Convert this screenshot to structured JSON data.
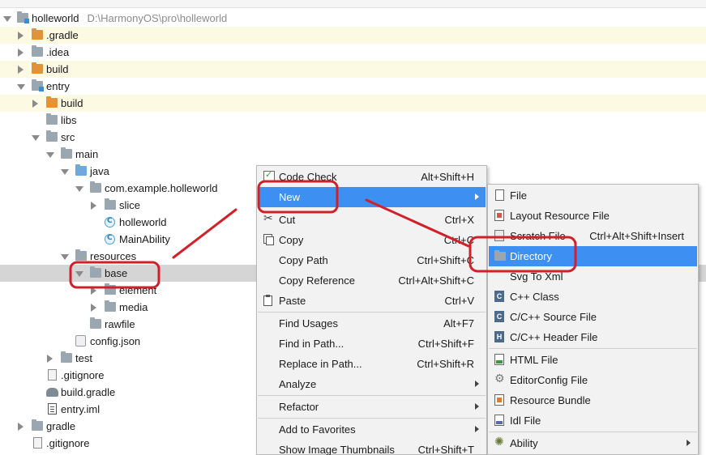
{
  "project": {
    "name": "holleworld",
    "path": "D:\\HarmonyOS\\pro\\holleworld"
  },
  "tree": {
    "items": [
      {
        "label": ".gradle",
        "icon": "folder-orange-icon"
      },
      {
        "label": ".idea",
        "icon": "folder-icon"
      },
      {
        "label": "build",
        "icon": "folder-orange-icon"
      },
      {
        "label": "entry",
        "icon": "module-folder-icon"
      },
      {
        "label": "build",
        "icon": "folder-orange-icon"
      },
      {
        "label": "libs",
        "icon": "folder-icon"
      },
      {
        "label": "src",
        "icon": "folder-icon"
      },
      {
        "label": "main",
        "icon": "folder-icon"
      },
      {
        "label": "java",
        "icon": "source-folder-icon"
      },
      {
        "label": "com.example.holleworld",
        "icon": "package-icon"
      },
      {
        "label": "slice",
        "icon": "package-icon"
      },
      {
        "label": "holleworld",
        "icon": "class-icon"
      },
      {
        "label": "MainAbility",
        "icon": "class-icon"
      },
      {
        "label": "resources",
        "icon": "resources-folder-icon"
      },
      {
        "label": "base",
        "icon": "folder-icon"
      },
      {
        "label": "element",
        "icon": "folder-icon"
      },
      {
        "label": "media",
        "icon": "folder-icon"
      },
      {
        "label": "rawfile",
        "icon": "folder-icon"
      },
      {
        "label": "config.json",
        "icon": "json-file-icon"
      },
      {
        "label": "test",
        "icon": "folder-icon"
      },
      {
        "label": ".gitignore",
        "icon": "gitignore-file-icon"
      },
      {
        "label": "build.gradle",
        "icon": "gradle-icon"
      },
      {
        "label": "entry.iml",
        "icon": "iml-file-icon"
      },
      {
        "label": "gradle",
        "icon": "folder-icon"
      },
      {
        "label": ".gitignore",
        "icon": "gitignore-file-icon"
      }
    ]
  },
  "context_menu": {
    "items": [
      {
        "label": "Code Check",
        "shortcut": "Alt+Shift+H",
        "icon": "code-check-icon"
      },
      {
        "label": "New",
        "shortcut": "",
        "icon": ""
      },
      {
        "label": "Cut",
        "shortcut": "Ctrl+X",
        "icon": "scissors-icon"
      },
      {
        "label": "Copy",
        "shortcut": "Ctrl+C",
        "icon": "copy-icon"
      },
      {
        "label": "Copy Path",
        "shortcut": "Ctrl+Shift+C",
        "icon": ""
      },
      {
        "label": "Copy Reference",
        "shortcut": "Ctrl+Alt+Shift+C",
        "icon": ""
      },
      {
        "label": "Paste",
        "shortcut": "Ctrl+V",
        "icon": "paste-icon"
      },
      {
        "label": "Find Usages",
        "shortcut": "Alt+F7",
        "icon": ""
      },
      {
        "label": "Find in Path...",
        "shortcut": "Ctrl+Shift+F",
        "icon": ""
      },
      {
        "label": "Replace in Path...",
        "shortcut": "Ctrl+Shift+R",
        "icon": ""
      },
      {
        "label": "Analyze",
        "shortcut": "",
        "icon": ""
      },
      {
        "label": "Refactor",
        "shortcut": "",
        "icon": ""
      },
      {
        "label": "Add to Favorites",
        "shortcut": "",
        "icon": ""
      },
      {
        "label": "Show Image Thumbnails",
        "shortcut": "Ctrl+Shift+T",
        "icon": ""
      }
    ]
  },
  "new_submenu": {
    "items": [
      {
        "label": "File",
        "shortcut": "",
        "icon": "file-icon"
      },
      {
        "label": "Layout Resource File",
        "shortcut": "",
        "icon": "layout-file-icon"
      },
      {
        "label": "Scratch File",
        "shortcut": "Ctrl+Alt+Shift+Insert",
        "icon": "scratch-file-icon"
      },
      {
        "label": "Directory",
        "shortcut": "",
        "icon": "directory-icon"
      },
      {
        "label": "Svg To Xml",
        "shortcut": "",
        "icon": ""
      },
      {
        "label": "C++ Class",
        "shortcut": "",
        "icon": "cpp-class-icon"
      },
      {
        "label": "C/C++ Source File",
        "shortcut": "",
        "icon": "cpp-source-icon"
      },
      {
        "label": "C/C++ Header File",
        "shortcut": "",
        "icon": "cpp-header-icon"
      },
      {
        "label": "HTML File",
        "shortcut": "",
        "icon": "html-file-icon"
      },
      {
        "label": "EditorConfig File",
        "shortcut": "",
        "icon": "gear-icon"
      },
      {
        "label": "Resource Bundle",
        "shortcut": "",
        "icon": "resource-bundle-icon"
      },
      {
        "label": "Idl File",
        "shortcut": "",
        "icon": "idl-file-icon"
      },
      {
        "label": "Ability",
        "shortcut": "",
        "icon": "ability-icon"
      }
    ]
  },
  "icon_glyphs": {
    "cpp": "C",
    "csrc": "C",
    "chdr": "H"
  },
  "colors": {
    "selection": "#3d8ff2",
    "highlight_row": "#fcfae2",
    "selected_row": "#d5d5d5",
    "annotation": "#d0202a"
  }
}
